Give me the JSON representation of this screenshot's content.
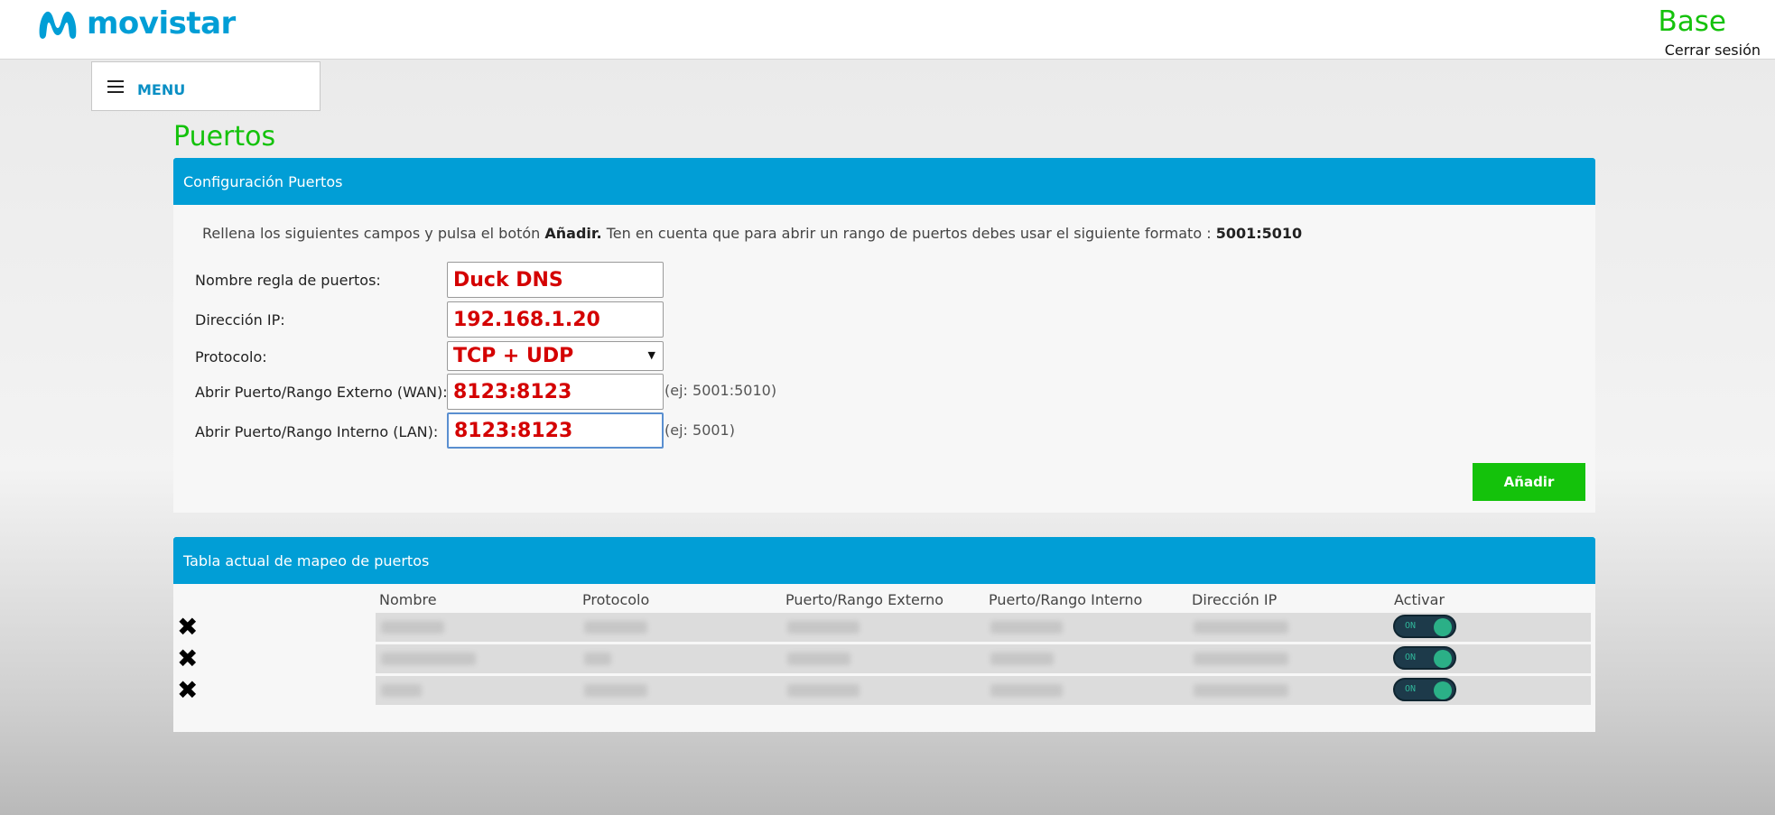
{
  "header": {
    "brand": "movistar",
    "title": "Base",
    "logout": "Cerrar sesión"
  },
  "menu": {
    "label": "MENU"
  },
  "page": {
    "title": "Puertos"
  },
  "config": {
    "header": "Configuración Puertos",
    "instructions_pre": "Rellena los siguientes campos y pulsa el botón ",
    "instructions_bold1": "Añadir.",
    "instructions_mid": " Ten en cuenta que para abrir un rango de puertos debes usar el siguiente formato : ",
    "instructions_bold2": "5001:5010",
    "fields": [
      {
        "label": "Nombre regla de puertos:",
        "value": "Duck DNS"
      },
      {
        "label": "Dirección IP:",
        "value": "192.168.1.20"
      },
      {
        "label": "Protocolo:",
        "value": "TCP + UDP"
      },
      {
        "label": "Abrir Puerto/Rango Externo (WAN):",
        "value": "8123:8123",
        "hint": "(ej: 5001:5010)"
      },
      {
        "label": "Abrir Puerto/Rango Interno (LAN):",
        "value": "8123:8123",
        "hint": "(ej: 5001)"
      }
    ],
    "add_button": "Añadir"
  },
  "mapping": {
    "header": "Tabla actual de mapeo de puertos",
    "columns": [
      "Nombre",
      "Protocolo",
      "Puerto/Rango Externo",
      "Puerto/Rango Interno",
      "Dirección IP",
      "Activar"
    ],
    "rows": [
      {
        "toggle": "ON"
      },
      {
        "toggle": "ON"
      },
      {
        "toggle": "ON"
      }
    ]
  },
  "colors": {
    "brand_blue": "#019ed6",
    "brand_green": "#14c20b",
    "input_text_red": "#d40000"
  }
}
